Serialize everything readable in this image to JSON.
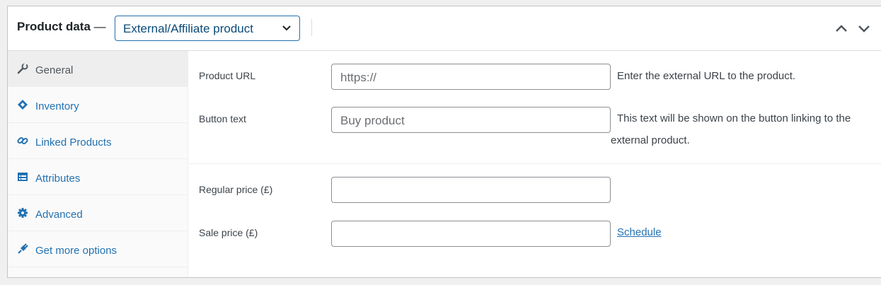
{
  "header": {
    "title": "Product data",
    "dash": "—",
    "product_type": "External/Affiliate product"
  },
  "sidebar": {
    "items": [
      {
        "label": "General",
        "icon": "wrench-icon",
        "active": true
      },
      {
        "label": "Inventory",
        "icon": "tag-icon"
      },
      {
        "label": "Linked Products",
        "icon": "link-icon"
      },
      {
        "label": "Attributes",
        "icon": "list-icon"
      },
      {
        "label": "Advanced",
        "icon": "gear-icon"
      },
      {
        "label": "Get more options",
        "icon": "plugin-icon"
      }
    ]
  },
  "fields": {
    "product_url": {
      "label": "Product URL",
      "placeholder": "https://",
      "description": "Enter the external URL to the product."
    },
    "button_text": {
      "label": "Button text",
      "placeholder": "Buy product",
      "description_line1": "This text will be shown on the button linking to the",
      "description_line2": "external product."
    },
    "regular_price": {
      "label": "Regular price (£)",
      "value": ""
    },
    "sale_price": {
      "label": "Sale price (£)",
      "value": "",
      "schedule_link": "Schedule"
    }
  },
  "colors": {
    "highlight": "#e0181b",
    "link": "#2271b1",
    "select_text": "#0a4b78"
  }
}
